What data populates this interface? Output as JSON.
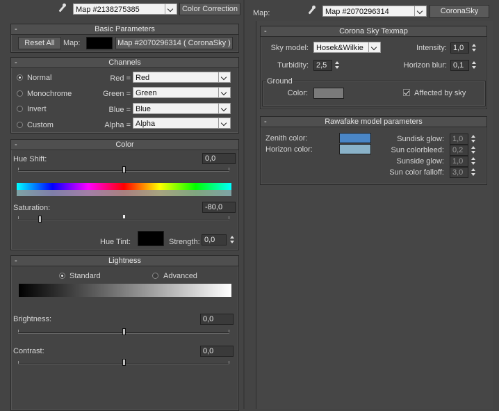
{
  "left_top": {
    "map_name": "Map #2138275385",
    "map_type": "Color Correction"
  },
  "right_top": {
    "map_label": "Map:",
    "map_name": "Map #2070296314",
    "map_type": "CoronaSky"
  },
  "basic": {
    "title": "Basic Parameters",
    "reset_label": "Reset All",
    "map_label": "Map:",
    "map_value": "Map #2070296314  ( CoronaSky )"
  },
  "channels": {
    "title": "Channels",
    "modes": [
      {
        "label": "Normal",
        "selected": true
      },
      {
        "label": "Monochrome",
        "selected": false
      },
      {
        "label": "Invert",
        "selected": false
      },
      {
        "label": "Custom",
        "selected": false
      }
    ],
    "rows": [
      {
        "label": "Red =",
        "value": "Red"
      },
      {
        "label": "Green =",
        "value": "Green"
      },
      {
        "label": "Blue =",
        "value": "Blue"
      },
      {
        "label": "Alpha =",
        "value": "Alpha"
      }
    ]
  },
  "color": {
    "title": "Color",
    "hue_shift_label": "Hue Shift:",
    "hue_shift": "0,0",
    "saturation_label": "Saturation:",
    "saturation": "-80,0",
    "hue_tint_label": "Hue Tint:",
    "strength_label": "Strength:",
    "strength": "0,0"
  },
  "lightness": {
    "title": "Lightness",
    "standard_label": "Standard",
    "advanced_label": "Advanced",
    "brightness_label": "Brightness:",
    "brightness": "0,0",
    "contrast_label": "Contrast:",
    "contrast": "0,0"
  },
  "sky": {
    "title": "Corona Sky Texmap",
    "sky_model_label": "Sky model:",
    "sky_model": "Hosek&Wilkie",
    "intensity_label": "Intensity:",
    "intensity": "1,0",
    "turbidity_label": "Turbidity:",
    "turbidity": "2,5",
    "horizon_blur_label": "Horizon blur:",
    "horizon_blur": "0,1",
    "ground_label": "Ground",
    "color_label": "Color:",
    "affected_label": "Affected by sky"
  },
  "rawafake": {
    "title": "Rawafake model parameters",
    "zenith_label": "Zenith color:",
    "horizon_label": "Horizon color:",
    "sundisk_label": "Sundisk glow:",
    "sundisk": "1,0",
    "bleed_label": "Sun colorbleed:",
    "bleed": "0,2",
    "sunside_label": "Sunside glow:",
    "sunside": "1,0",
    "falloff_label": "Sun color falloff:",
    "falloff": "3,0"
  },
  "colors": {
    "zenith": "#4a86c6",
    "horizon": "#8ab2c8",
    "ground": "#7a7a7a",
    "hue_tint": "#000000"
  }
}
